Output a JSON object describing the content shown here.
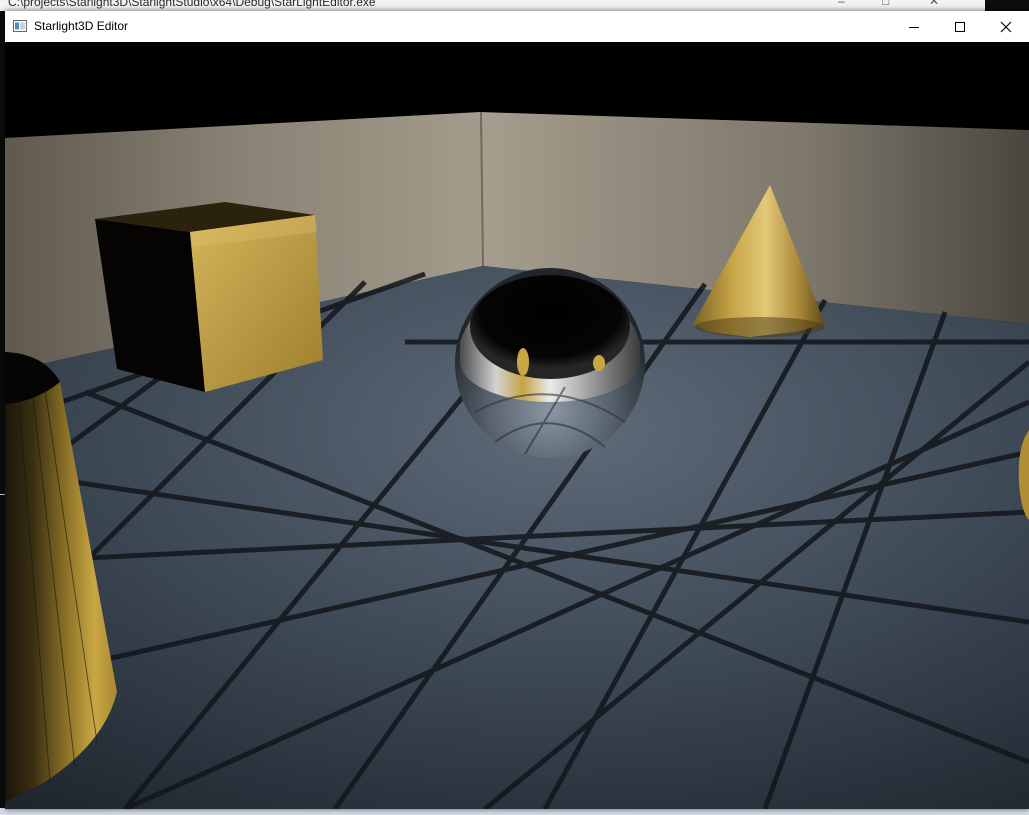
{
  "background_console": {
    "title": "C:\\projects\\Starlight3D\\StarlightStudio\\x64\\Debug\\StarLightEditor.exe"
  },
  "window": {
    "title": "Starlight3D Editor",
    "icon": "app-window-icon",
    "controls": {
      "minimize": "minimize-icon",
      "maximize": "maximize-icon",
      "close": "close-icon"
    }
  },
  "viewport": {
    "scene_objects": [
      "cube",
      "sphere",
      "cone",
      "cylinder",
      "tiled-floor",
      "walls"
    ],
    "colors": {
      "gold": "#c9a53c",
      "floor": "#3e4a58",
      "wall": "#9a9282"
    }
  }
}
